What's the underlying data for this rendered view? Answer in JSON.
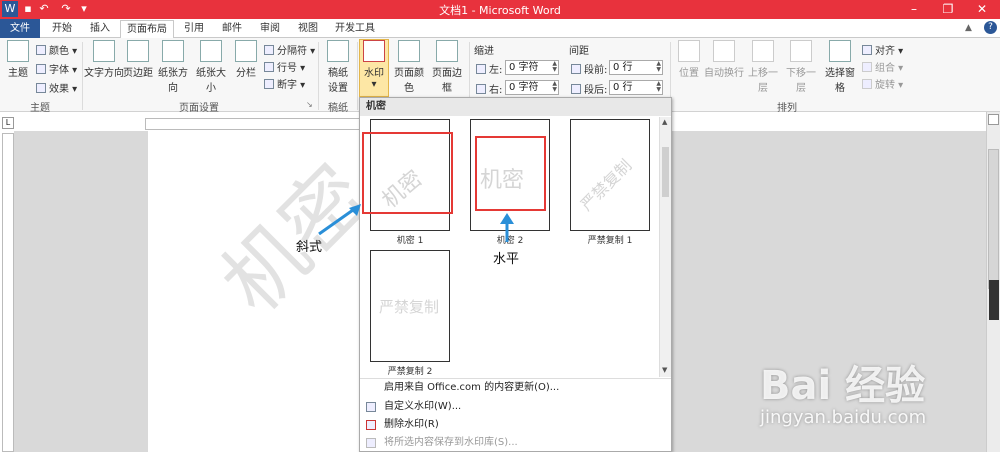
{
  "window": {
    "title": "文档1 - Microsoft Word",
    "qat_icons": [
      "word-logo-icon",
      "save-icon",
      "undo-icon",
      "redo-icon",
      "customize-icon"
    ],
    "controls": [
      "minimize-icon",
      "restore-icon",
      "close-icon"
    ]
  },
  "tabs": {
    "file": "文件",
    "items": [
      "开始",
      "插入",
      "页面布局",
      "引用",
      "邮件",
      "审阅",
      "视图",
      "开发工具"
    ],
    "active": "页面布局"
  },
  "ribbon": {
    "theme": {
      "group": "主题",
      "big": "主题",
      "colors": "颜色",
      "fonts": "字体",
      "effects": "效果"
    },
    "page_setup": {
      "group": "页面设置",
      "text_dir": "文字方向",
      "margins": "页边距",
      "orientation": "纸张方向",
      "size": "纸张大小",
      "columns": "分栏",
      "breaks": "分隔符",
      "line_numbers": "行号",
      "hyphenation": "断字"
    },
    "manuscript": {
      "group": "稿纸",
      "label_line1": "稿纸",
      "label_line2": "设置"
    },
    "page_bg": {
      "watermark": "水印",
      "page_color": "页面颜色",
      "page_border": "页面边框"
    },
    "indent": {
      "title": "缩进",
      "left_label": "左:",
      "left_value": "0 字符",
      "right_label": "右:",
      "right_value": "0 字符"
    },
    "spacing": {
      "title": "间距",
      "before_label": "段前:",
      "before_value": "0 行",
      "after_label": "段后:",
      "after_value": "0 行"
    },
    "arrange": {
      "group": "排列",
      "position": "位置",
      "wrap": "自动换行",
      "forward": "上移一层",
      "backward": "下移一层",
      "selection_pane": "选择窗格",
      "align": "对齐",
      "group_btn": "组合",
      "rotate": "旋转"
    }
  },
  "gallery": {
    "header": "机密",
    "thumbs": [
      {
        "caption": "机密 1",
        "text": "机密",
        "style": "diagonal"
      },
      {
        "caption": "机密 2",
        "text": "机密",
        "style": "horizontal"
      },
      {
        "caption": "严禁复制 1",
        "text": "严禁复制",
        "style": "diagonal"
      },
      {
        "caption": "严禁复制 2",
        "text": "严禁复制",
        "style": "horizontal"
      }
    ],
    "menu": [
      {
        "label": "启用来自 Office.com 的内容更新(O)...",
        "enabled": true
      },
      {
        "label": "自定义水印(W)...",
        "enabled": true
      },
      {
        "label": "删除水印(R)",
        "enabled": true
      },
      {
        "label": "将所选内容保存到水印库(S)...",
        "enabled": false
      }
    ]
  },
  "document": {
    "watermark_text": "机密"
  },
  "annotations": {
    "diagonal_label": "斜式",
    "horizontal_label": "水平"
  },
  "colors": {
    "title_bar": "#e8323d",
    "file_tab": "#2b5797",
    "annotation": "#e53935",
    "arrow": "#2a8fd8"
  },
  "brand": {
    "logo_text": "Bai 经验",
    "url": "jingyan.baidu.com"
  }
}
